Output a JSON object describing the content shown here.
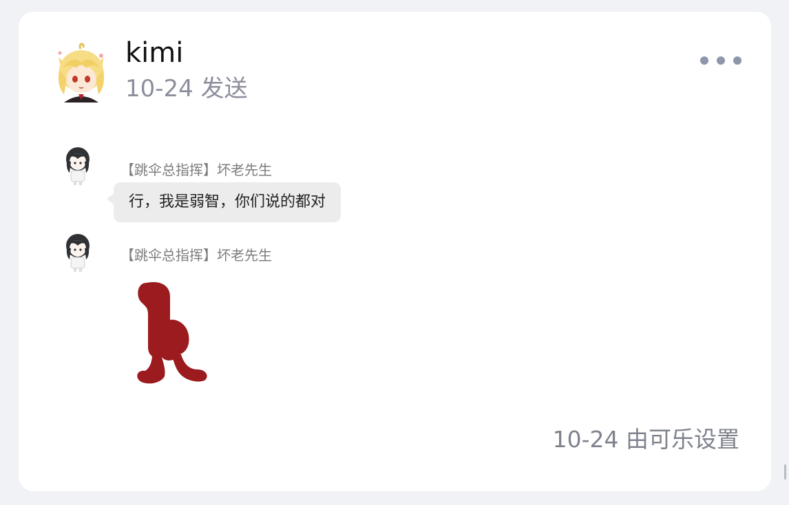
{
  "post": {
    "author": "kimi",
    "meta": "10-24 发送",
    "footer": "10-24 由可乐设置"
  },
  "icons": {
    "more": "more-horizontal-icon",
    "avatar_main": "blonde-anime-avatar",
    "avatar_chat": "dark-hair-chibi-avatar",
    "sticker": "red-blob-figure-sticker"
  },
  "messages": [
    {
      "sender": "【跳伞总指挥】坏老先生",
      "text": "行，我是弱智，你们说的都对"
    },
    {
      "sender": "【跳伞总指挥】坏老先生",
      "sticker": "red-blob-figure-sticker"
    }
  ],
  "colors": {
    "background": "#f1f2f6",
    "card": "#ffffff",
    "bubble": "#ececec",
    "sticker_red": "#9b1b1f",
    "muted_text": "#8c8f9b"
  }
}
